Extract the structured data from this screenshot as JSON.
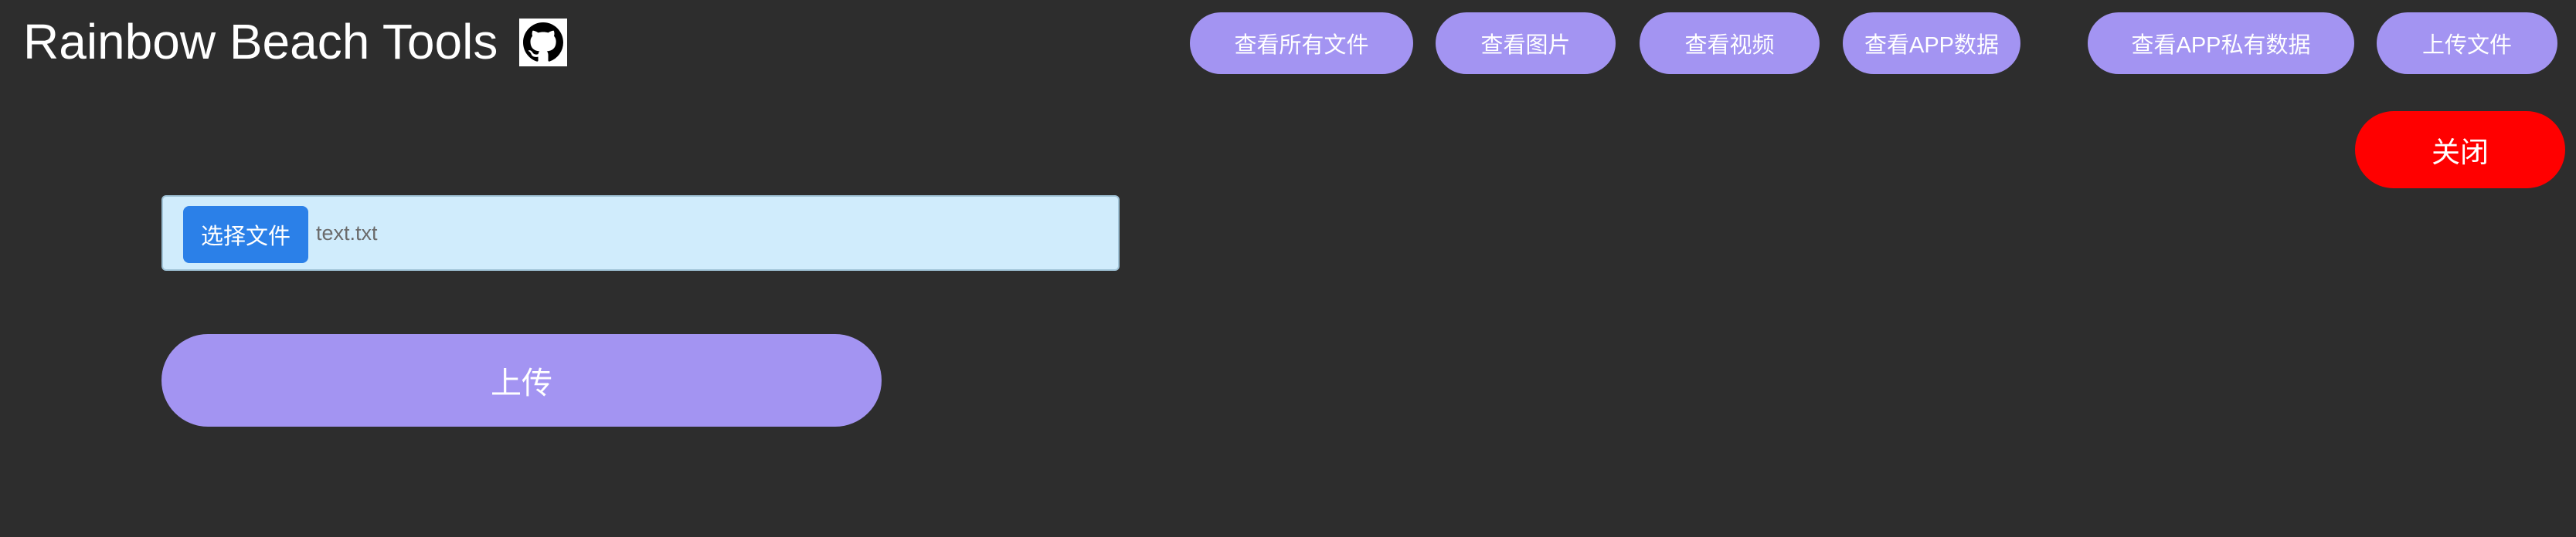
{
  "header": {
    "title": "Rainbow Beach Tools",
    "github_icon": "github-icon"
  },
  "nav": [
    {
      "label": "查看所有文件"
    },
    {
      "label": "查看图片"
    },
    {
      "label": "查看视频"
    },
    {
      "label": "查看APP数据"
    },
    {
      "label": "查看APP私有数据"
    },
    {
      "label": "上传文件"
    }
  ],
  "close": {
    "label": "关闭"
  },
  "upload_form": {
    "choose_label": "选择文件",
    "file_name": "text.txt",
    "submit_label": "上传"
  },
  "colors": {
    "background": "#2d2d2d",
    "accent": "#a394f2",
    "danger": "#ff0000",
    "file_button": "#2b80e8",
    "file_field": "#d0ecfc"
  }
}
